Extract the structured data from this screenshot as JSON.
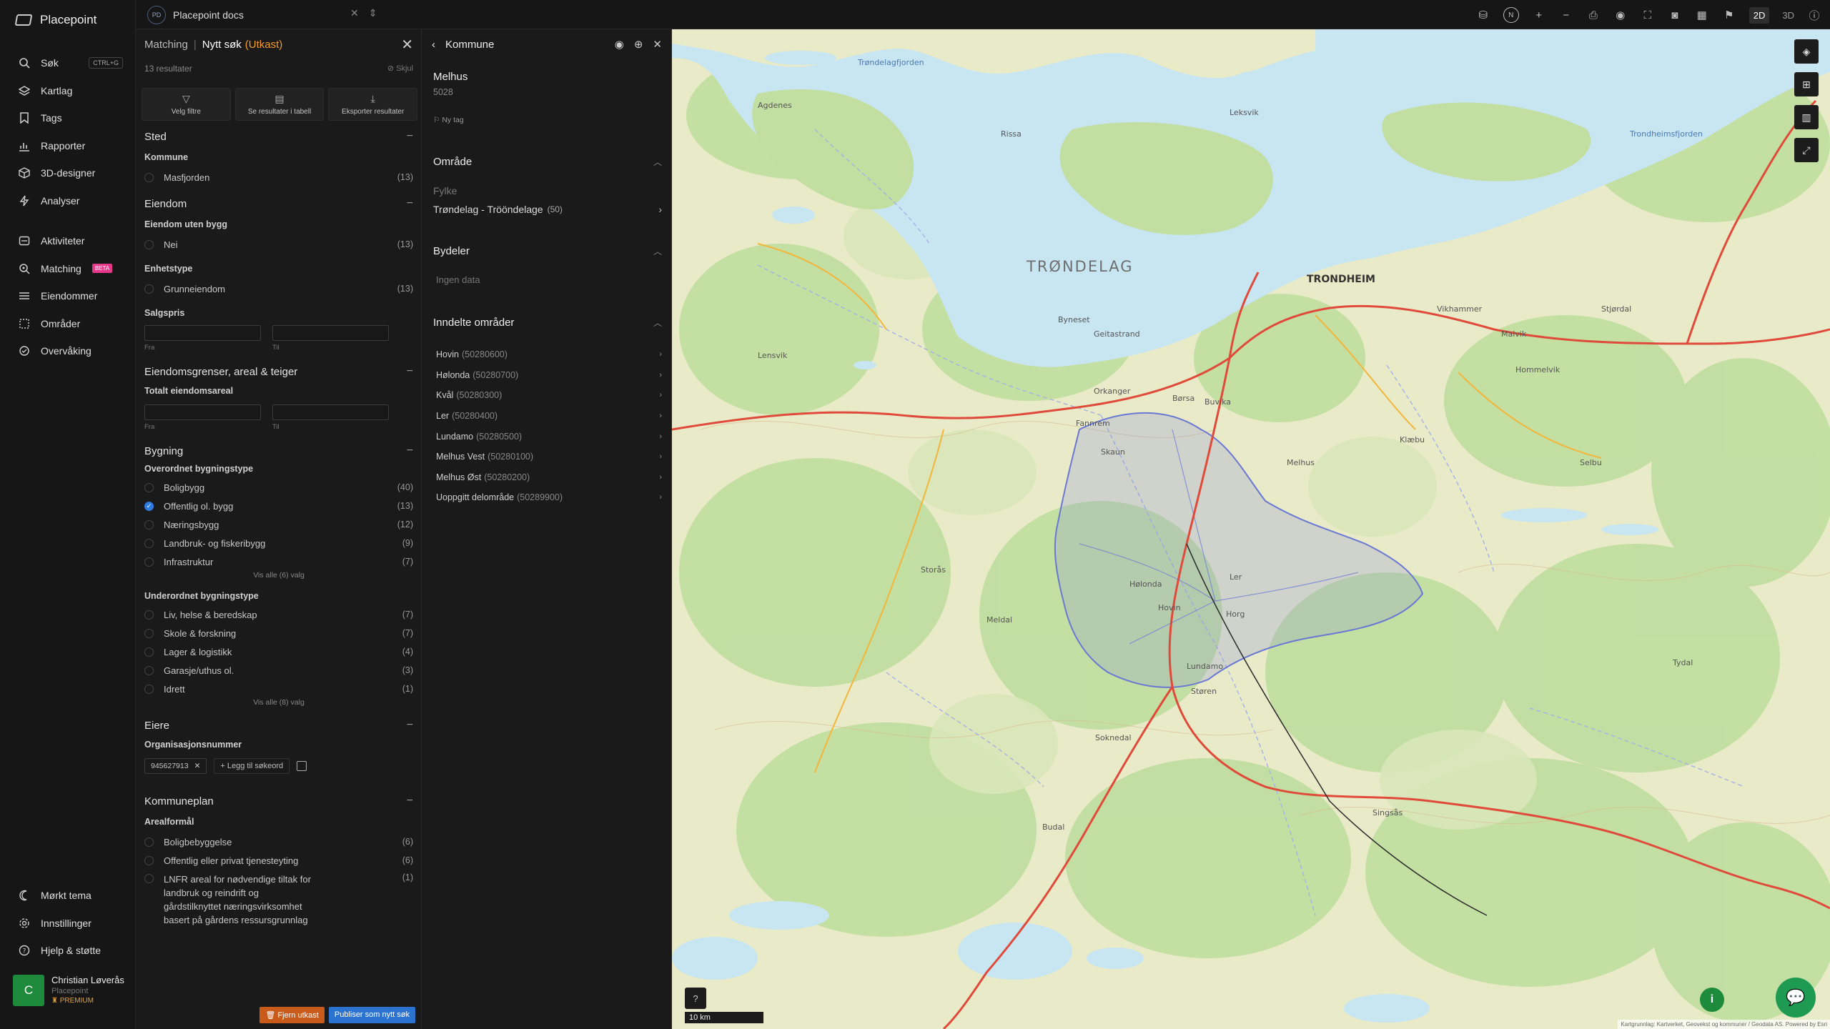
{
  "app": {
    "name": "Placepoint"
  },
  "workspace": {
    "badge": "PD",
    "name": "Placepoint docs"
  },
  "topbar": {
    "compass": "N",
    "mode_2d": "2D",
    "mode_3d": "3D"
  },
  "sidebar": {
    "items": [
      {
        "label": "Søk",
        "icon": "search-icon",
        "shortcut": "CTRL+G"
      },
      {
        "label": "Kartlag",
        "icon": "layers-icon"
      },
      {
        "label": "Tags",
        "icon": "bookmark-icon"
      },
      {
        "label": "Rapporter",
        "icon": "chart-icon"
      },
      {
        "label": "3D-designer",
        "icon": "cube-icon"
      },
      {
        "label": "Analyser",
        "icon": "bolt-icon"
      },
      {
        "label": "Aktiviteter",
        "icon": "activity-icon"
      },
      {
        "label": "Matching",
        "icon": "matching-icon",
        "badge": "BETA"
      },
      {
        "label": "Eiendommer",
        "icon": "property-icon"
      },
      {
        "label": "Områder",
        "icon": "area-icon"
      },
      {
        "label": "Overvåking",
        "icon": "monitor-icon"
      }
    ],
    "bottom": [
      {
        "label": "Mørkt tema",
        "icon": "moon-icon"
      },
      {
        "label": "Innstillinger",
        "icon": "gear-icon"
      },
      {
        "label": "Hjelp & støtte",
        "icon": "help-icon"
      }
    ],
    "user": {
      "initial": "C",
      "name": "Christian Løverås",
      "org": "Placepoint",
      "plan": "PREMIUM"
    }
  },
  "filter": {
    "crumb": "Matching",
    "title": "Nytt søk",
    "draft": "(Utkast)",
    "results": "13 resultater",
    "hide": "Skjul",
    "actions": [
      {
        "label": "Velg filtre",
        "icon": "filter-icon"
      },
      {
        "label": "Se resultater i tabell",
        "icon": "table-icon"
      },
      {
        "label": "Eksporter resultater",
        "icon": "download-icon"
      }
    ],
    "sted": {
      "title": "Sted",
      "sub": "Kommune",
      "options": [
        {
          "label": "Masfjorden",
          "count": "(13)"
        }
      ]
    },
    "eiendom": {
      "title": "Eiendom",
      "sub1": "Eiendom uten bygg",
      "opt1": [
        {
          "label": "Nei",
          "count": "(13)"
        }
      ],
      "sub2": "Enhetstype",
      "opt2": [
        {
          "label": "Grunneiendom",
          "count": "(13)"
        }
      ],
      "sub3": "Salgspris",
      "from": "Fra",
      "to": "Til"
    },
    "grenser": {
      "title": "Eiendomsgrenser, areal & teiger",
      "sub": "Totalt eiendomsareal",
      "from": "Fra",
      "to": "Til"
    },
    "bygning": {
      "title": "Bygning",
      "sub1": "Overordnet bygningstype",
      "opt1": [
        {
          "label": "Boligbygg",
          "count": "(40)",
          "checked": false
        },
        {
          "label": "Offentlig ol. bygg",
          "count": "(13)",
          "checked": true
        },
        {
          "label": "Næringsbygg",
          "count": "(12)",
          "checked": false
        },
        {
          "label": "Landbruk- og fiskeribygg",
          "count": "(9)",
          "checked": false
        },
        {
          "label": "Infrastruktur",
          "count": "(7)",
          "checked": false
        }
      ],
      "more1": "Vis alle (6) valg",
      "sub2": "Underordnet bygningstype",
      "opt2": [
        {
          "label": "Liv, helse & beredskap",
          "count": "(7)"
        },
        {
          "label": "Skole & forskning",
          "count": "(7)"
        },
        {
          "label": "Lager & logistikk",
          "count": "(4)"
        },
        {
          "label": "Garasje/uthus ol.",
          "count": "(3)"
        },
        {
          "label": "Idrett",
          "count": "(1)"
        }
      ],
      "more2": "Vis alle (8) valg"
    },
    "eiere": {
      "title": "Eiere",
      "sub": "Organisasjonsnummer",
      "chip": "945627913",
      "add": "Legg til søkeord"
    },
    "kommuneplan": {
      "title": "Kommuneplan",
      "sub": "Arealformål",
      "options": [
        {
          "label": "Boligbebyggelse",
          "count": "(6)"
        },
        {
          "label": "Offentlig eller privat tjenesteyting",
          "count": "(6)"
        },
        {
          "label": "LNFR areal for nødvendige tiltak for landbruk og reindrift og gårdstilknyttet næringsvirksomhet basert på gårdens ressursgrunnlag",
          "count": "(1)"
        }
      ]
    },
    "footer": {
      "remove": "Fjern utkast",
      "publish": "Publiser som nytt søk"
    }
  },
  "kommune": {
    "header": "Kommune",
    "name": "Melhus",
    "number": "5028",
    "tag": "Ny tag",
    "omrade": {
      "title": "Område",
      "label": "Fylke",
      "value": "Trøndelag - Trööndelage",
      "count": "(50)"
    },
    "bydeler": {
      "title": "Bydeler",
      "empty": "Ingen data"
    },
    "inndelte": {
      "title": "Inndelte områder",
      "items": [
        {
          "name": "Hovin",
          "code": "(50280600)"
        },
        {
          "name": "Hølonda",
          "code": "(50280700)"
        },
        {
          "name": "Kvål",
          "code": "(50280300)"
        },
        {
          "name": "Ler",
          "code": "(50280400)"
        },
        {
          "name": "Lundamo",
          "code": "(50280500)"
        },
        {
          "name": "Melhus Vest",
          "code": "(50280100)"
        },
        {
          "name": "Melhus Øst",
          "code": "(50280200)"
        },
        {
          "name": "Uoppgitt delområde",
          "code": "(50289900)"
        }
      ]
    }
  },
  "map": {
    "labels": {
      "region": "TRØNDELAG",
      "city": "TRONDHEIM",
      "places": [
        "Hølonda",
        "Hovin",
        "Melhus",
        "Lundamo",
        "Ler",
        "Støren",
        "Horg",
        "Skaun",
        "Børsa",
        "Buvika",
        "Orkanger",
        "Fannrem",
        "Klæbu",
        "Malvik",
        "Stjørdal",
        "Leksvik",
        "Rissa",
        "Agdenes",
        "Meldal",
        "Storås",
        "Soknedal",
        "Budal",
        "Singsås",
        "Selbu",
        "Tydal",
        "Byneset",
        "Vikhammer",
        "Hommelvik",
        "Geitastrand",
        "Lensvik",
        "Trøndelagfjorden",
        "Trondheimsfjorden"
      ]
    },
    "scale": "10 km",
    "attribution": "Kartgrunnlag: Kartverket, Geovekst og kommuner / Geodata AS. Powered by Esri",
    "colors": {
      "land": "#e7e9c6",
      "forest": "#c4dfa0",
      "water": "#c9e6f3",
      "road": "#e04a3a",
      "selection": "#7a86d8"
    }
  }
}
